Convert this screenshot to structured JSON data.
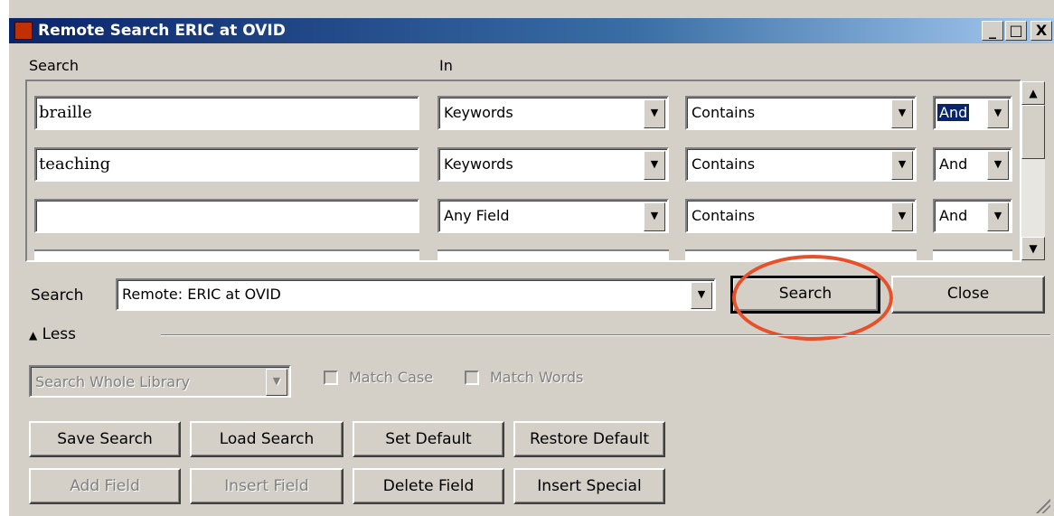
{
  "window": {
    "title": "Remote Search ERIC at OVID",
    "caption_buttons": [
      "_",
      "□",
      "X"
    ]
  },
  "headers": {
    "search": "Search",
    "in": "In"
  },
  "rows": [
    {
      "term": "braille",
      "field": "Keywords",
      "operator": "Contains",
      "bool": "And",
      "bool_selected": true
    },
    {
      "term": "teaching",
      "field": "Keywords",
      "operator": "Contains",
      "bool": "And",
      "bool_selected": false
    },
    {
      "term": "",
      "field": "Any Field",
      "operator": "Contains",
      "bool": "And",
      "bool_selected": false
    }
  ],
  "search_in": {
    "label": "Search",
    "value": "Remote: ERIC at OVID"
  },
  "buttons": {
    "search": "Search",
    "close": "Close"
  },
  "less_toggle": {
    "label": "Less",
    "icon": "double-up-arrow-icon"
  },
  "options": {
    "scope": "Search Whole Library",
    "match_case": "Match Case",
    "match_words": "Match Words"
  },
  "actions": {
    "save_search": "Save Search",
    "load_search": "Load Search",
    "set_default": "Set Default",
    "restore_default": "Restore Default",
    "add_field": "Add Field",
    "insert_field": "Insert Field",
    "delete_field": "Delete Field",
    "insert_special": "Insert Special"
  },
  "colors": {
    "title_bar": "#0a246a",
    "highlight": "#e8502a",
    "face": "#d4d0c8"
  }
}
